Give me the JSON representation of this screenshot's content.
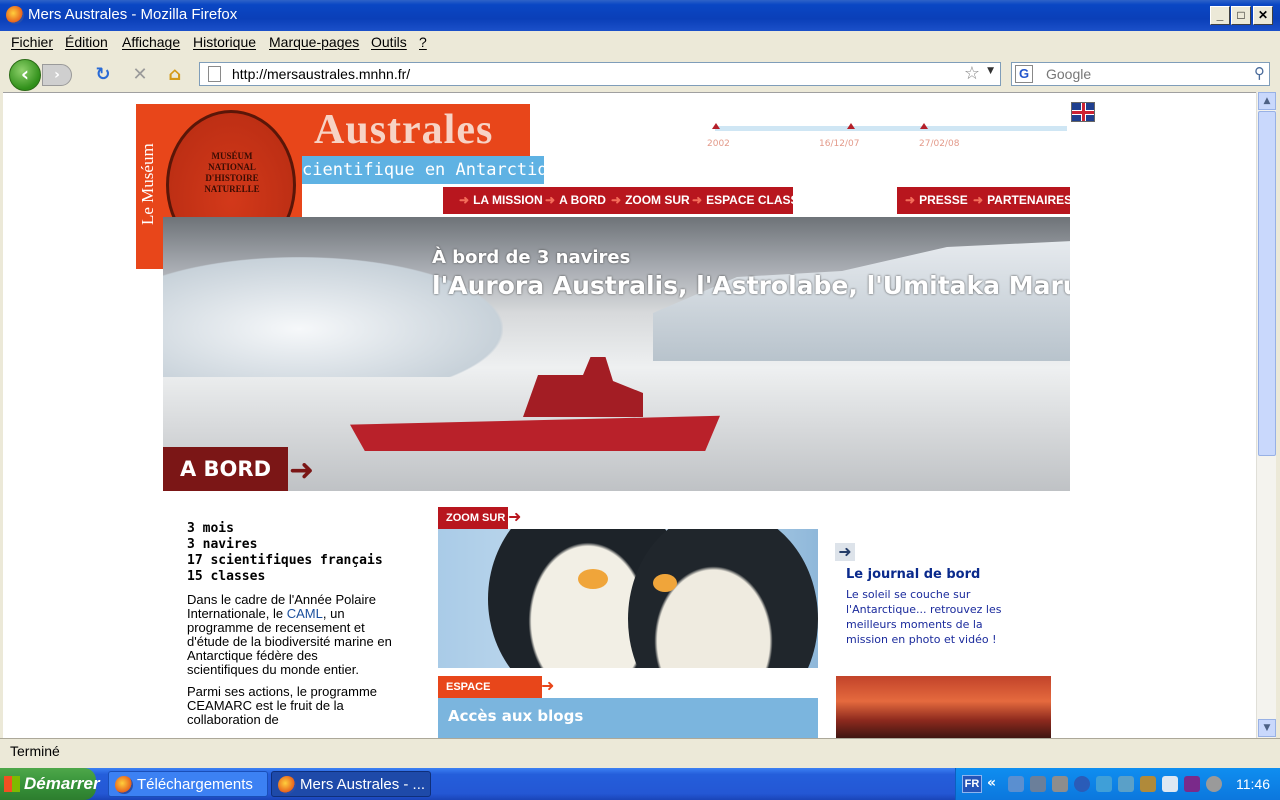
{
  "window": {
    "title": "Mers Australes - Mozilla Firefox",
    "controls": {
      "minimize": "_",
      "maximize": "□",
      "close": "✕"
    }
  },
  "menu": [
    "Fichier",
    "Édition",
    "Affichage",
    "Historique",
    "Marque-pages",
    "Outils",
    "?"
  ],
  "navbar": {
    "back": "‹",
    "forward": "›",
    "reload": "↻",
    "stop": "✕",
    "home": "⌂",
    "url": "http://mersaustrales.mnhn.fr/",
    "search_engine": "G",
    "search_placeholder": "Google"
  },
  "status": "Terminé",
  "site": {
    "museum_vertical": "Le Muséum",
    "seal_text": "MUSÉUM NATIONAL D'HISTOIRE NATURELLE",
    "title": "Australes",
    "subtitle": "cientifique en Antarctique",
    "timeline_labels": [
      "2002",
      "16/12/07",
      "27/02/08"
    ],
    "nav_left": [
      "LA MISSION",
      "A BORD",
      "ZOOM SUR",
      "ESPACE CLASSES"
    ],
    "nav_right": [
      "PRESSE",
      "PARTENAIRES"
    ],
    "hero_caption_1": "À bord de 3 navires",
    "hero_caption_2": "l'Aurora Australis, l'Astrolabe, l'Umitaka Maru",
    "hero_tag": "A BORD",
    "facts": [
      "3 mois",
      "3 navires",
      "17 scientifiques français",
      "15 classes"
    ],
    "para1_before": "Dans le cadre de l'Année Polaire Internationale, le ",
    "para1_link": "CAML",
    "para1_after": ", un programme de recensement et d'étude de la biodiversité marine en Antarctique fédère des scientifiques du monde entier.",
    "para2": "Parmi ses actions, le programme CEAMARC est le fruit de la collaboration de",
    "zoom_label": "ZOOM SUR",
    "classes_label": "ESPACE CLASSES",
    "blogs_label": "Accès aux blogs",
    "journal_title": "Le journal de bord",
    "journal_text": "Le soleil se couche sur l'Antarctique... retrouvez les meilleurs moments de la mission en photo et vidéo !"
  },
  "taskbar": {
    "start": "Démarrer",
    "tasks": [
      "Téléchargements",
      "Mers Australes - ..."
    ],
    "lang": "FR",
    "tray_chevron": "«",
    "clock": "11:46"
  },
  "colors": {
    "accent_red": "#b8161e",
    "orange": "#e8461a",
    "sky": "#5fb2e3"
  }
}
